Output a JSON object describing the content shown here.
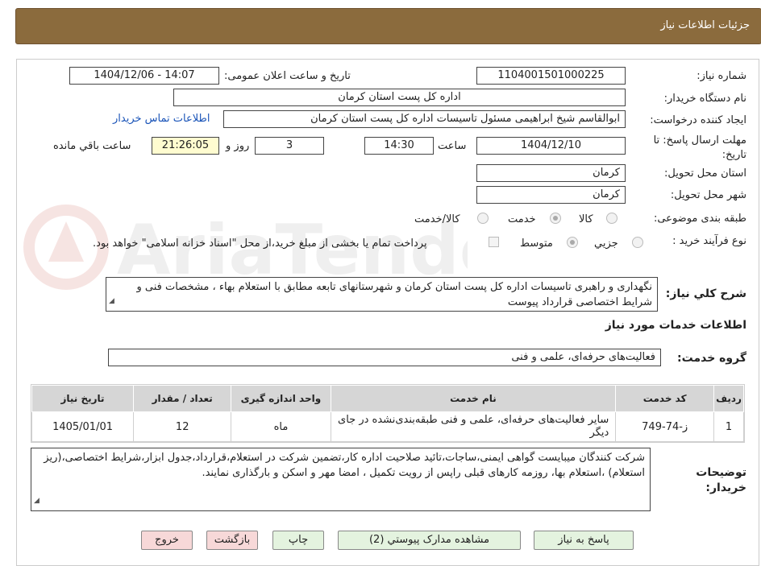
{
  "header": {
    "title": "جزئیات اطلاعات نیاز"
  },
  "form": {
    "need_number_label": "شماره نیاز:",
    "need_number": "1104001501000225",
    "announce_label": "تاریخ و ساعت اعلان عمومی:",
    "announce_value": "1404/12/06 - 14:07",
    "buyer_org_label": "نام دستگاه خریدار:",
    "buyer_org": "اداره کل پست استان کرمان",
    "requester_label": "ایجاد کننده درخواست:",
    "requester": "ابوالقاسم شیخ ابراهیمی مسئول تاسیسات اداره کل پست استان کرمان",
    "contact_link": "اطلاعات تماس خریدار",
    "deadline_label": "مهلت ارسال پاسخ: تا تاریخ:",
    "deadline_date": "1404/12/10",
    "time_label": "ساعت",
    "deadline_time": "14:30",
    "days_value": "3",
    "days_label": "روز و",
    "remaining_time": "21:26:05",
    "remaining_label": "ساعت باقي مانده",
    "province_label": "استان محل تحویل:",
    "province": "کرمان",
    "city_label": "شهر محل تحویل:",
    "city": "کرمان",
    "category_label": "طبقه بندی موضوعی:",
    "category_options": [
      "کالا",
      "خدمت",
      "کالا/خدمت"
    ],
    "category_selected": "خدمت",
    "process_label": "نوع فرآیند خرید :",
    "process_options": [
      "جزيي",
      "متوسط"
    ],
    "process_selected": "متوسط",
    "payment_note": "پرداخت تمام یا بخشی از مبلغ خرید،از محل \"اسناد خزانه اسلامی\" خواهد بود."
  },
  "description": {
    "label": "شرح كلي نیاز:",
    "text": "نگهداری و راهبری تاسیسات اداره کل پست استان کرمان و شهرستانهای تابعه مطابق با استعلام بهاء ، مشخصات فنی و شرایط اختصاصی قرارداد پیوست"
  },
  "services": {
    "section_title": "اطلاعات خدمات مورد نیاز",
    "group_label": "گروه خدمت:",
    "group_value": "فعالیت‌های حرفه‌ای، علمی و فنی",
    "columns": [
      "رديف",
      "کد خدمت",
      "نام خدمت",
      "واحد اندازه گیری",
      "تعداد / مقدار",
      "تاریخ نیاز"
    ],
    "rows": [
      {
        "row": "1",
        "code": "ز-74-749",
        "name": "سایر فعالیت‌های حرفه‌ای، علمی و فنی طبقه‌بندی‌نشده در جای دیگر",
        "unit": "ماه",
        "qty": "12",
        "date": "1405/01/01"
      }
    ]
  },
  "buyer_notes": {
    "label": "توضیحات خریدار:",
    "text": "شرکت کنندگان میبایست گواهی ایمنی،ساجات،تائید صلاحیت اداره کار،تضمین شرکت در استعلام،قرارداد،جدول ابزار،شرایط اختصاصی،(ریز استعلام) ،استعلام بها، روزمه کارهای قبلی راپس از رویت تکمیل ، امضا مهر و اسکن و بارگذاری نمایند."
  },
  "buttons": {
    "reply": "پاسخ به نیاز",
    "attachments": "مشاهده مدارک پیوستي (2)",
    "print": "چاپ",
    "back": "بازگشت",
    "exit": "خروج"
  },
  "watermark": {
    "text": "AriaTender.neT"
  },
  "colors": {
    "header_bg": "#8b6b3d",
    "remaining_bg": "#fffcd0",
    "green_button": "#e4f3df",
    "red_button": "#f7d8d8",
    "link": "#1a54b8"
  }
}
